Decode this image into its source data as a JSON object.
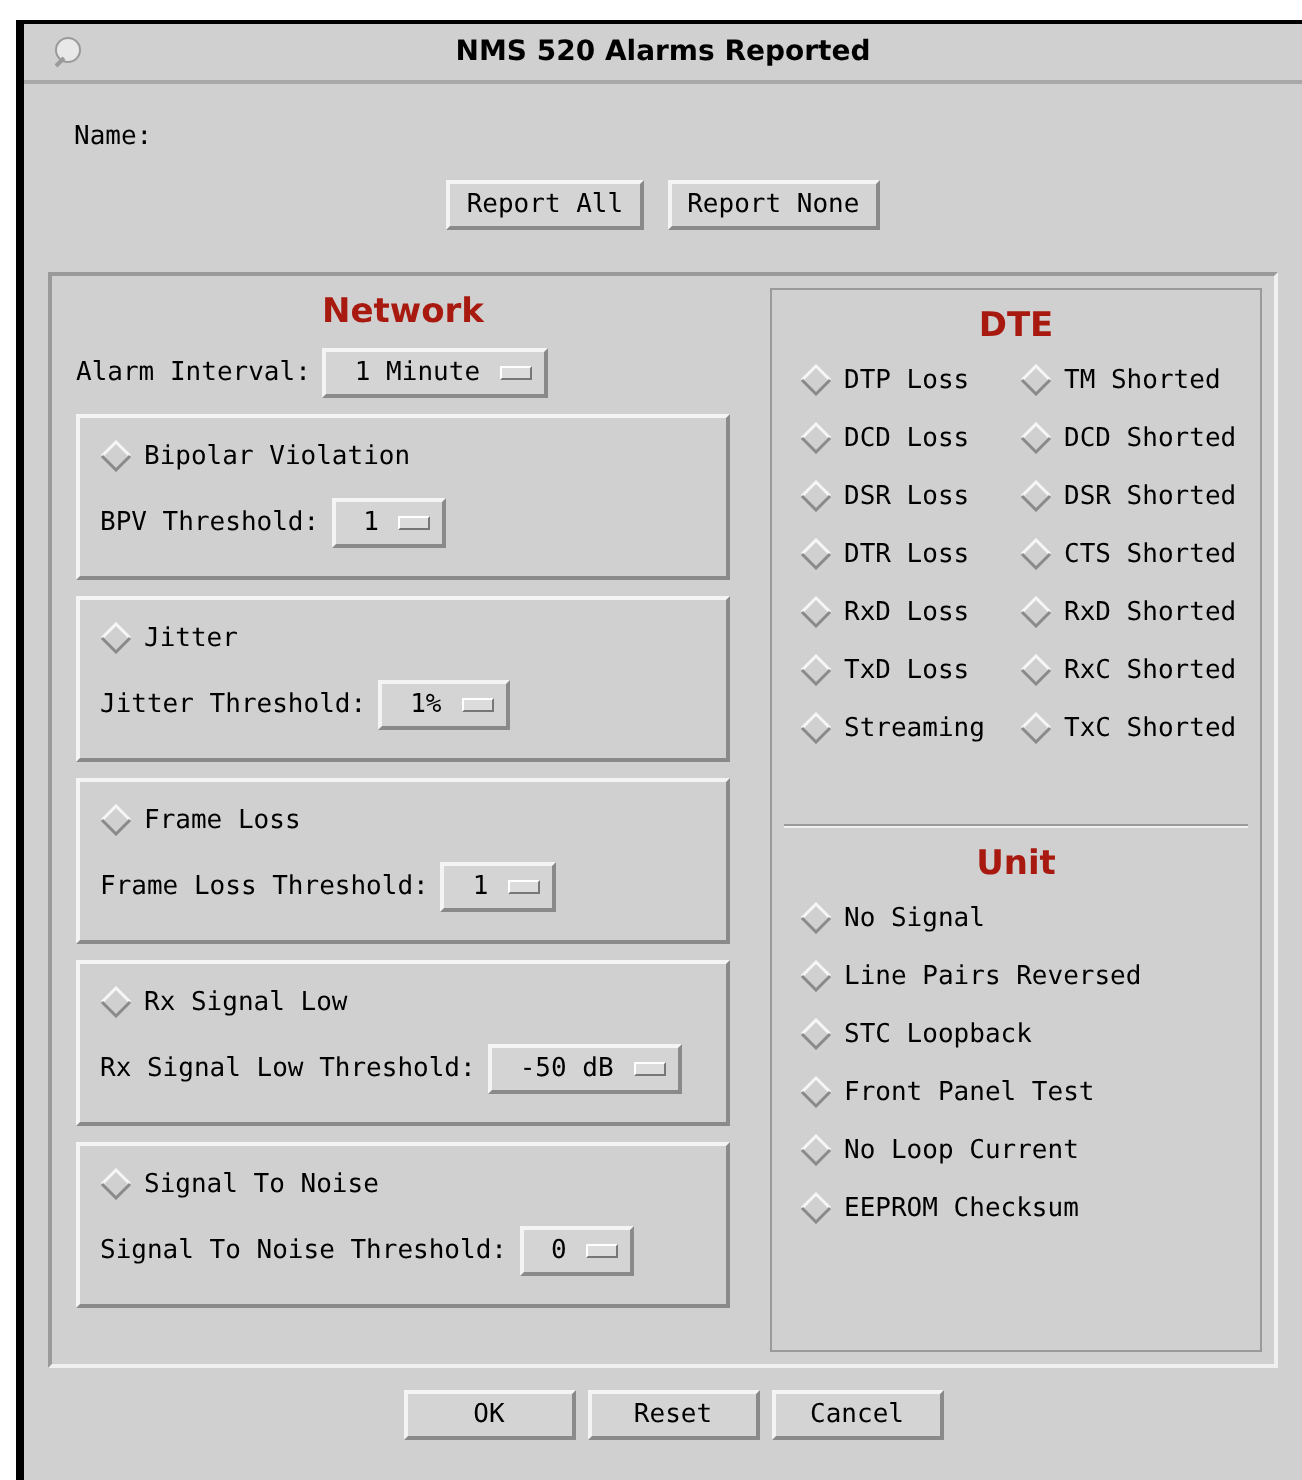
{
  "window": {
    "title": "NMS 520 Alarms Reported"
  },
  "name_label": "Name:",
  "top_buttons": [
    "Report All",
    "Report None"
  ],
  "network": {
    "heading": "Network",
    "interval": {
      "label": "Alarm Interval:",
      "value": "1 Minute"
    },
    "alarms": [
      {
        "label": "Bipolar Violation",
        "checked": false,
        "threshold_label": "BPV Threshold:",
        "threshold": "1"
      },
      {
        "label": "Jitter",
        "checked": false,
        "threshold_label": "Jitter Threshold:",
        "threshold": "1%"
      },
      {
        "label": "Frame Loss",
        "checked": false,
        "threshold_label": "Frame Loss Threshold:",
        "threshold": "1"
      },
      {
        "label": "Rx Signal Low",
        "checked": false,
        "threshold_label": "Rx Signal Low Threshold:",
        "threshold": "-50 dB"
      },
      {
        "label": "Signal To Noise",
        "checked": false,
        "threshold_label": "Signal To Noise Threshold:",
        "threshold": "0"
      }
    ]
  },
  "dte": {
    "heading": "DTE",
    "items": [
      {
        "label": "DTP Loss",
        "checked": false
      },
      {
        "label": "TM Shorted",
        "checked": false
      },
      {
        "label": "DCD Loss",
        "checked": false
      },
      {
        "label": "DCD Shorted",
        "checked": false
      },
      {
        "label": "DSR Loss",
        "checked": false
      },
      {
        "label": "DSR Shorted",
        "checked": false
      },
      {
        "label": "DTR Loss",
        "checked": false
      },
      {
        "label": "CTS Shorted",
        "checked": false
      },
      {
        "label": "RxD Loss",
        "checked": false
      },
      {
        "label": "RxD Shorted",
        "checked": false
      },
      {
        "label": "TxD Loss",
        "checked": false
      },
      {
        "label": "RxC Shorted",
        "checked": false
      },
      {
        "label": "Streaming",
        "checked": false
      },
      {
        "label": "TxC Shorted",
        "checked": false
      }
    ]
  },
  "unit": {
    "heading": "Unit",
    "items": [
      {
        "label": "No Signal",
        "checked": false
      },
      {
        "label": "Line Pairs Reversed",
        "checked": false
      },
      {
        "label": "STC Loopback",
        "checked": false
      },
      {
        "label": "Front Panel Test",
        "checked": false
      },
      {
        "label": "No Loop Current",
        "checked": false
      },
      {
        "label": "EEPROM Checksum",
        "checked": false
      }
    ]
  },
  "buttons": [
    "OK",
    "Reset",
    "Cancel"
  ]
}
